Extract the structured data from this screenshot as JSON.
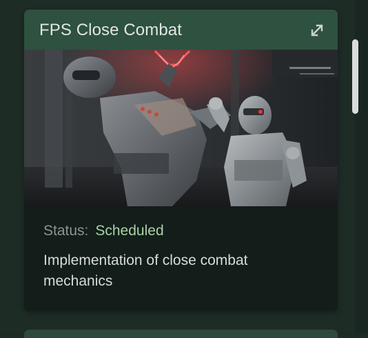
{
  "card": {
    "title": "FPS Close Combat",
    "image_alt": "Two armored soldiers engaged in hand-to-hand combat under red neon lights",
    "status_label": "Status:",
    "status_value": "Scheduled",
    "description": "Implementation of close combat mechanics"
  },
  "colors": {
    "header": "#2e5140",
    "card_body": "#131d19",
    "status_value": "#a9d3a7",
    "background": "#1e2c26"
  },
  "icons": {
    "expand": "expand-icon"
  }
}
